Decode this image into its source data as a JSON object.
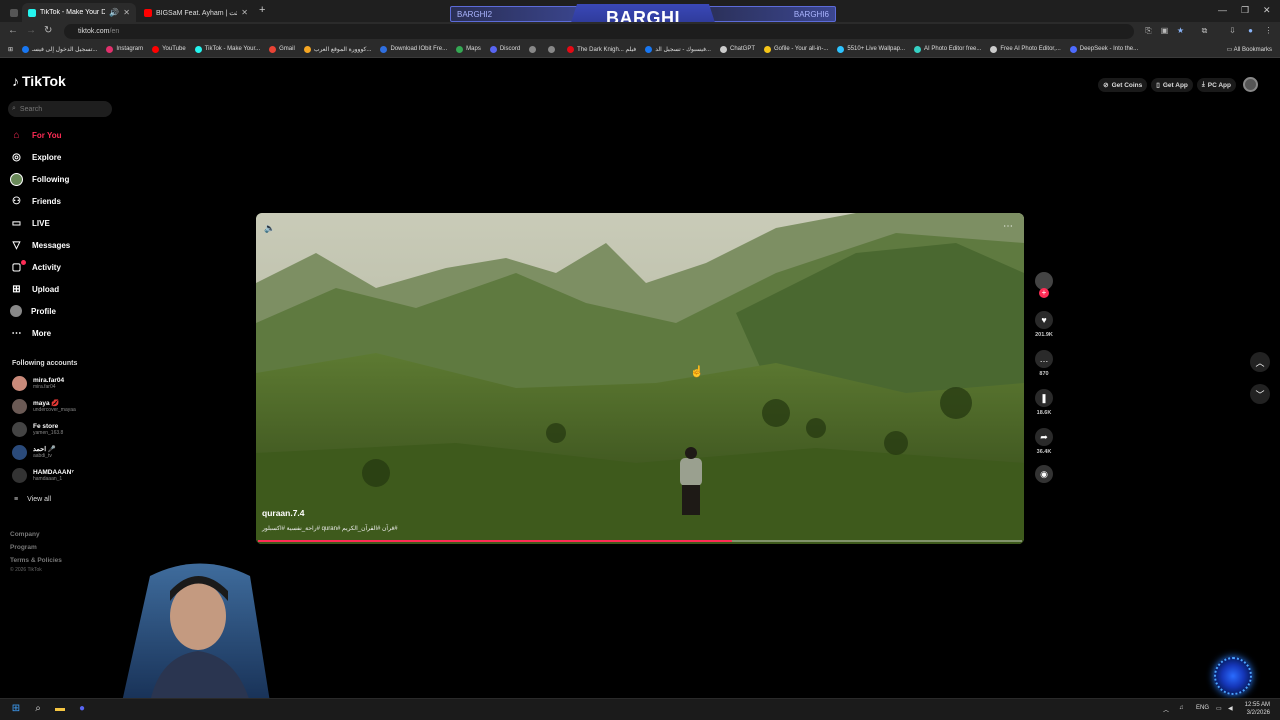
{
  "browser": {
    "tabs": [
      {
        "title": "TikTok - Make Your Day",
        "color": "#25f4ee"
      },
      {
        "title": "BIGSaM Feat. Ayham | إن شئت",
        "color": "#ff0000"
      }
    ],
    "url": "tiktok.com",
    "url_suffix": "/en",
    "stream_banner": {
      "center": "BARGHI",
      "left": "BARGHI2",
      "right": "BARGHI6"
    },
    "bookmarks": [
      {
        "label": "تسجيل الدخول إلى فيسـ...",
        "color": "#1877f2"
      },
      {
        "label": "Instagram",
        "color": "#e1306c"
      },
      {
        "label": "YouTube",
        "color": "#ff0000"
      },
      {
        "label": "TikTok - Make Your...",
        "color": "#25f4ee"
      },
      {
        "label": "Gmail",
        "color": "#ea4335"
      },
      {
        "label": "كووورة الموقع العرب...",
        "color": "#f5a623"
      },
      {
        "label": "Download IObit Fre...",
        "color": "#2f6fe0"
      },
      {
        "label": "Maps",
        "color": "#34a853"
      },
      {
        "label": "Discord",
        "color": "#5865f2"
      },
      {
        "label": "",
        "color": "#888888"
      },
      {
        "label": "",
        "color": "#888888"
      },
      {
        "label": "The Dark Knigh... فيلم",
        "color": "#e50914"
      },
      {
        "label": "فيسبوك - تسجيل الد...",
        "color": "#1877f2"
      },
      {
        "label": "ChatGPT",
        "color": "#cccccc"
      },
      {
        "label": "Gofile - Your all-in-...",
        "color": "#f5c518"
      },
      {
        "label": "5510+ Live Wallpap...",
        "color": "#2dc3ff"
      },
      {
        "label": "AI Photo Editor free...",
        "color": "#36d1c4"
      },
      {
        "label": "Free AI Photo Editor,...",
        "color": "#cccccc"
      },
      {
        "label": "DeepSeek - Into the...",
        "color": "#4d6bfe"
      }
    ],
    "all_bookmarks": "All Bookmarks"
  },
  "tiktok": {
    "logo": "TikTok",
    "search_placeholder": "Search",
    "nav": [
      {
        "label": "For You",
        "icon": "home-icon",
        "active": true
      },
      {
        "label": "Explore",
        "icon": "compass-icon"
      },
      {
        "label": "Following",
        "icon": "following-avatar"
      },
      {
        "label": "Friends",
        "icon": "friends-icon"
      },
      {
        "label": "LIVE",
        "icon": "live-icon"
      },
      {
        "label": "Messages",
        "icon": "messages-icon"
      },
      {
        "label": "Activity",
        "icon": "activity-icon"
      },
      {
        "label": "Upload",
        "icon": "upload-icon"
      },
      {
        "label": "Profile",
        "icon": "profile-icon"
      },
      {
        "label": "More",
        "icon": "more-icon"
      }
    ],
    "following_title": "Following accounts",
    "accounts": [
      {
        "name": "mira.far04",
        "handle": "mira.far04",
        "color": "#c98a7a"
      },
      {
        "name": "maya 💋",
        "handle": "undercover_mayaa",
        "color": "#6b5a55"
      },
      {
        "name": "Fe store",
        "handle": "yamen_163.8",
        "color": "#444444"
      },
      {
        "name": "احمد 🎤",
        "handle": "aabdi_tv",
        "color": "#2a4a7a"
      },
      {
        "name": "HAMDAAAN⁷",
        "handle": "hamdaaan_1",
        "color": "#333333"
      }
    ],
    "view_all": "View all",
    "footer": [
      "Company",
      "Program",
      "Terms & Policies"
    ],
    "copyright": "© 2026 TikTok",
    "top_buttons": [
      "Get Coins",
      "Get App",
      "PC App"
    ],
    "video": {
      "author": "quraan.7.4",
      "caption": "#قرآن #القرآن_الكريم #quran #راحة_نفسية #اكسبلور",
      "progress": 0.62
    },
    "actions": [
      {
        "name": "like",
        "count": "201.9K",
        "glyph": "♥"
      },
      {
        "name": "comment",
        "count": "870",
        "glyph": "…"
      },
      {
        "name": "favorite",
        "count": "18.6K",
        "glyph": "❚"
      },
      {
        "name": "share",
        "count": "36.4K",
        "glyph": "➦"
      }
    ]
  },
  "taskbar": {
    "lang": "ENG",
    "time": "12:55 AM",
    "date": "3/2/2026"
  }
}
